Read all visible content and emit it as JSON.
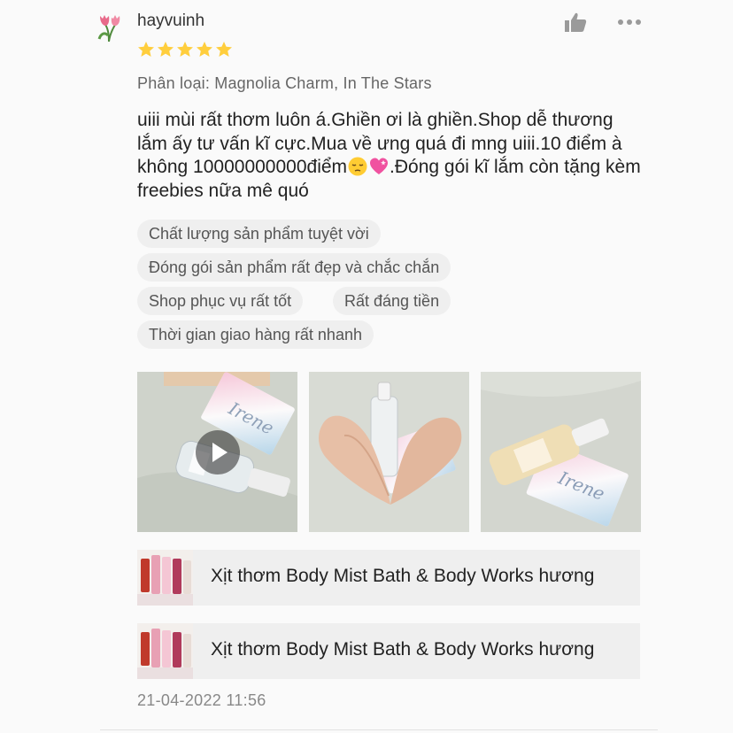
{
  "review": {
    "username": "hayvuinh",
    "avatar_icon": "tulip-icon",
    "rating": 5,
    "rating_max": 5,
    "star_color": "#ffce3d",
    "variant_label": "Phân loại:",
    "variant_value": "Magnolia Charm, In The Stars",
    "comment_part1": "uiii mùi rất thơm luôn á.Ghiền ơi là ghiền.Shop dễ thương lắm ấy tư vấn kĩ cực.Mua về ưng quá đi mng uiii.10 điểm à không 10000000000điểm",
    "comment_part2": ".Đóng gói kĩ lắm còn tặng kèm freebies nữa mê quó",
    "emojis": [
      "pensive-face-emoji",
      "pink-heart-emoji"
    ],
    "tags": [
      "Chất lượng sản phẩm tuyệt vời",
      "Đóng gói sản phẩm rất đẹp và chắc chắn",
      "Shop phục vụ rất tốt",
      "Rất đáng tiền",
      "Thời gian giao hàng rất nhanh"
    ],
    "media": [
      {
        "type": "video",
        "icon": "play-icon"
      },
      {
        "type": "image"
      },
      {
        "type": "image"
      }
    ],
    "products": [
      {
        "name": "Xịt thơm Body Mist Bath & Body Works hương"
      },
      {
        "name": "Xịt thơm Body Mist Bath & Body Works hương"
      }
    ],
    "timestamp": "21-04-2022 11:56",
    "actions": {
      "like_icon": "thumbs-up-icon",
      "more_icon": "more-dots-icon"
    }
  }
}
